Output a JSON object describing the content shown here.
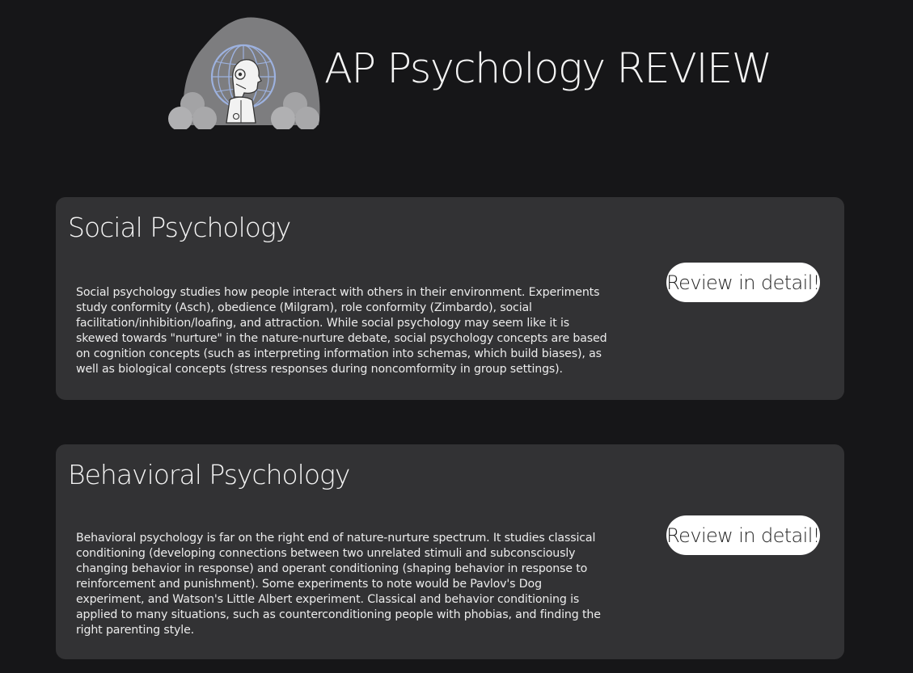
{
  "header": {
    "title": "AP Psychology REVIEW",
    "logo_icon": "robot-globe-cave-icon"
  },
  "sections": [
    {
      "title": "Social Psychology",
      "description": "Social psychology studies how people interact with others in their environment. Experiments study conformity (Asch), obedience (Milgram), role conformity (Zimbardo), social facilitation/inhibition/loafing, and attraction. While social psychology may seem like it is skewed towards \"nurture\" in the nature-nurture debate, social psychology concepts are based on cognition concepts (such as interpreting information into schemas, which build biases), as well as biological concepts (stress responses during noncomformity in group settings).",
      "button_label": "Review in detail!"
    },
    {
      "title": "Behavioral Psychology",
      "description": "Behavioral psychology is far on the right end of nature-nurture spectrum. It studies classical conditioning (developing connections between two unrelated stimuli and subconsciously changing behavior in response) and operant conditioning (shaping behavior in response to reinforcement and punishment). Some experiments to note would be Pavlov's Dog experiment, and Watson's Little Albert experiment. Classical and behavior conditioning is applied to many situations, such as counterconditioning people with phobias, and finding the right parenting style.",
      "button_label": "Review in detail!"
    }
  ],
  "colors": {
    "background": "#161618",
    "card": "#323234",
    "button": "#ffffff",
    "text": "#f4f4f4"
  }
}
